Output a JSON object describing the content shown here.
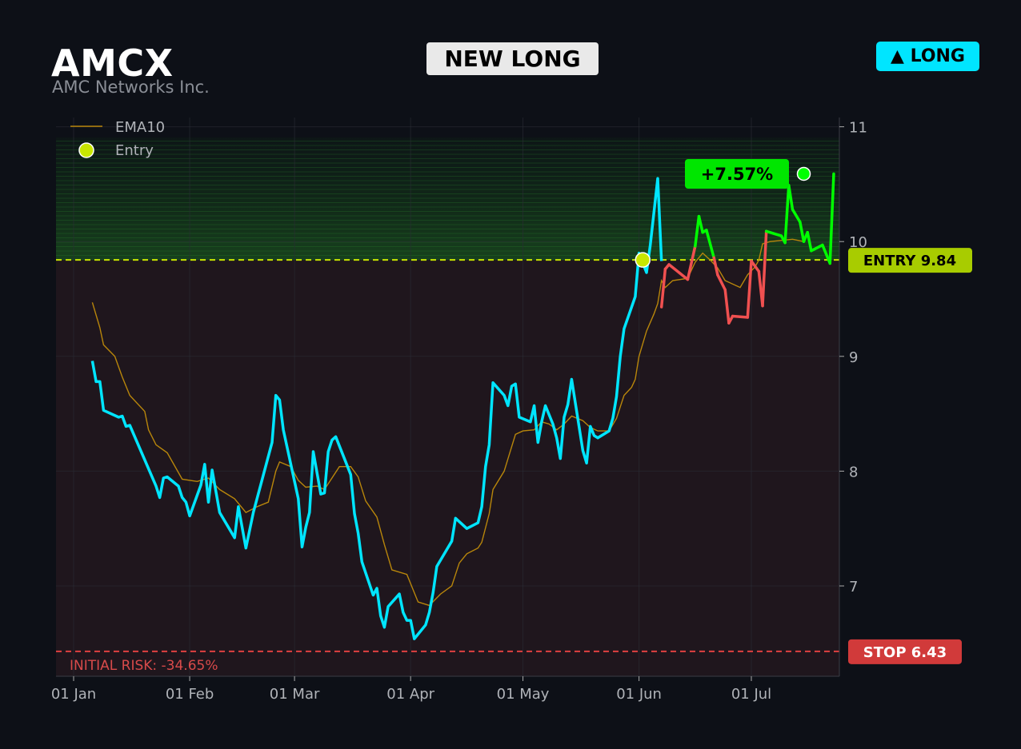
{
  "header": {
    "ticker": "AMCX",
    "company": "AMC Networks Inc.",
    "signal_label": "NEW LONG",
    "direction_badge": "▲ LONG"
  },
  "colors": {
    "background": "#0d1017",
    "price_line": "#00e5ff",
    "ema_line": "#b8860b",
    "profit_line": "#00ff00",
    "loss_line": "#f05050",
    "entry_line": "#c8e600",
    "stop_line": "#e04040",
    "entry_badge": "#a8cc00",
    "stop_badge": "#d13a3a",
    "gain_badge": "#00e600"
  },
  "chart_data": {
    "type": "line",
    "title": "",
    "xlabel": "",
    "ylabel": "",
    "ylim": [
      6.2,
      11.1
    ],
    "grid": true,
    "legend_position": "top-left",
    "x_ticks": [
      {
        "date": "2025-01-01",
        "label": "01 Jan"
      },
      {
        "date": "2025-02-01",
        "label": "01 Feb"
      },
      {
        "date": "2025-03-01",
        "label": "01 Mar"
      },
      {
        "date": "2025-04-01",
        "label": "01 Apr"
      },
      {
        "date": "2025-05-01",
        "label": "01 May"
      },
      {
        "date": "2025-06-01",
        "label": "01 Jun"
      },
      {
        "date": "2025-07-01",
        "label": "01 Jul"
      }
    ],
    "y_ticks": [
      7,
      8,
      9,
      10,
      11
    ],
    "legend": [
      "EMA10",
      "Entry"
    ],
    "entry": {
      "date": "2025-06-02",
      "price": 9.84,
      "label": "ENTRY 9.84"
    },
    "stop": {
      "price": 6.43,
      "label": "STOP 6.43"
    },
    "exit_marker": {
      "date": "2025-07-15",
      "price": 10.59
    },
    "gain_label": "+7.57%",
    "risk_label": "INITIAL RISK: -34.65%",
    "price": [
      [
        "2025-01-06",
        8.96
      ],
      [
        "2025-01-07",
        8.78
      ],
      [
        "2025-01-08",
        8.78
      ],
      [
        "2025-01-09",
        8.53
      ],
      [
        "2025-01-13",
        8.47
      ],
      [
        "2025-01-14",
        8.48
      ],
      [
        "2025-01-15",
        8.39
      ],
      [
        "2025-01-16",
        8.4
      ],
      [
        "2025-01-23",
        7.87
      ],
      [
        "2025-01-24",
        7.77
      ],
      [
        "2025-01-25",
        7.94
      ],
      [
        "2025-01-26",
        7.95
      ],
      [
        "2025-01-29",
        7.87
      ],
      [
        "2025-01-30",
        7.77
      ],
      [
        "2025-01-31",
        7.73
      ],
      [
        "2025-02-01",
        7.61
      ],
      [
        "2025-02-04",
        7.88
      ],
      [
        "2025-02-05",
        8.06
      ],
      [
        "2025-02-06",
        7.73
      ],
      [
        "2025-02-07",
        8.01
      ],
      [
        "2025-02-09",
        7.64
      ],
      [
        "2025-02-13",
        7.42
      ],
      [
        "2025-02-14",
        7.69
      ],
      [
        "2025-02-16",
        7.33
      ],
      [
        "2025-02-18",
        7.64
      ],
      [
        "2025-02-23",
        8.25
      ],
      [
        "2025-02-24",
        8.66
      ],
      [
        "2025-02-25",
        8.62
      ],
      [
        "2025-02-26",
        8.36
      ],
      [
        "2025-03-02",
        7.76
      ],
      [
        "2025-03-03",
        7.34
      ],
      [
        "2025-03-04",
        7.51
      ],
      [
        "2025-03-05",
        7.64
      ],
      [
        "2025-03-06",
        8.17
      ],
      [
        "2025-03-08",
        7.8
      ],
      [
        "2025-03-09",
        7.81
      ],
      [
        "2025-03-10",
        8.17
      ],
      [
        "2025-03-11",
        8.27
      ],
      [
        "2025-03-12",
        8.3
      ],
      [
        "2025-03-16",
        7.97
      ],
      [
        "2025-03-17",
        7.63
      ],
      [
        "2025-03-18",
        7.46
      ],
      [
        "2025-03-19",
        7.21
      ],
      [
        "2025-03-22",
        6.92
      ],
      [
        "2025-03-23",
        6.98
      ],
      [
        "2025-03-24",
        6.74
      ],
      [
        "2025-03-25",
        6.64
      ],
      [
        "2025-03-26",
        6.82
      ],
      [
        "2025-03-29",
        6.93
      ],
      [
        "2025-03-30",
        6.77
      ],
      [
        "2025-03-31",
        6.7
      ],
      [
        "2025-04-01",
        6.7
      ],
      [
        "2025-04-02",
        6.54
      ],
      [
        "2025-04-05",
        6.66
      ],
      [
        "2025-04-06",
        6.77
      ],
      [
        "2025-04-07",
        6.94
      ],
      [
        "2025-04-08",
        7.17
      ],
      [
        "2025-04-12",
        7.39
      ],
      [
        "2025-04-13",
        7.59
      ],
      [
        "2025-04-16",
        7.5
      ],
      [
        "2025-04-19",
        7.55
      ],
      [
        "2025-04-20",
        7.69
      ],
      [
        "2025-04-21",
        8.04
      ],
      [
        "2025-04-22",
        8.23
      ],
      [
        "2025-04-23",
        8.77
      ],
      [
        "2025-04-26",
        8.66
      ],
      [
        "2025-04-27",
        8.57
      ],
      [
        "2025-04-28",
        8.74
      ],
      [
        "2025-04-29",
        8.76
      ],
      [
        "2025-04-30",
        8.47
      ],
      [
        "2025-05-03",
        8.43
      ],
      [
        "2025-05-04",
        8.57
      ],
      [
        "2025-05-05",
        8.25
      ],
      [
        "2025-05-06",
        8.43
      ],
      [
        "2025-05-07",
        8.57
      ],
      [
        "2025-05-09",
        8.41
      ],
      [
        "2025-05-10",
        8.29
      ],
      [
        "2025-05-11",
        8.11
      ],
      [
        "2025-05-12",
        8.47
      ],
      [
        "2025-05-13",
        8.58
      ],
      [
        "2025-05-14",
        8.8
      ],
      [
        "2025-05-17",
        8.18
      ],
      [
        "2025-05-18",
        8.07
      ],
      [
        "2025-05-19",
        8.39
      ],
      [
        "2025-05-20",
        8.31
      ],
      [
        "2025-05-21",
        8.29
      ],
      [
        "2025-05-24",
        8.35
      ],
      [
        "2025-05-25",
        8.46
      ],
      [
        "2025-05-26",
        8.65
      ],
      [
        "2025-05-27",
        9.0
      ],
      [
        "2025-05-28",
        9.24
      ],
      [
        "2025-05-31",
        9.52
      ],
      [
        "2025-06-01",
        9.9
      ],
      [
        "2025-06-03",
        9.73
      ],
      [
        "2025-06-04",
        9.97
      ],
      [
        "2025-06-06",
        10.55
      ],
      [
        "2025-06-07",
        9.83
      ]
    ],
    "ema10": [
      [
        "2025-01-06",
        9.47
      ],
      [
        "2025-01-08",
        9.25
      ],
      [
        "2025-01-09",
        9.1
      ],
      [
        "2025-01-12",
        9.0
      ],
      [
        "2025-01-14",
        8.82
      ],
      [
        "2025-01-16",
        8.66
      ],
      [
        "2025-01-20",
        8.52
      ],
      [
        "2025-01-21",
        8.36
      ],
      [
        "2025-01-23",
        8.23
      ],
      [
        "2025-01-26",
        8.16
      ],
      [
        "2025-01-30",
        7.93
      ],
      [
        "2025-02-03",
        7.91
      ],
      [
        "2025-02-06",
        7.94
      ],
      [
        "2025-02-09",
        7.84
      ],
      [
        "2025-02-13",
        7.76
      ],
      [
        "2025-02-16",
        7.64
      ],
      [
        "2025-02-19",
        7.69
      ],
      [
        "2025-02-22",
        7.73
      ],
      [
        "2025-02-24",
        8.0
      ],
      [
        "2025-02-25",
        8.08
      ],
      [
        "2025-02-28",
        8.04
      ],
      [
        "2025-03-02",
        7.92
      ],
      [
        "2025-03-04",
        7.86
      ],
      [
        "2025-03-07",
        7.87
      ],
      [
        "2025-03-09",
        7.84
      ],
      [
        "2025-03-13",
        8.04
      ],
      [
        "2025-03-16",
        8.04
      ],
      [
        "2025-03-18",
        7.95
      ],
      [
        "2025-03-20",
        7.74
      ],
      [
        "2025-03-23",
        7.6
      ],
      [
        "2025-03-25",
        7.36
      ],
      [
        "2025-03-27",
        7.14
      ],
      [
        "2025-03-31",
        7.1
      ],
      [
        "2025-04-03",
        6.86
      ],
      [
        "2025-04-06",
        6.83
      ],
      [
        "2025-04-09",
        6.93
      ],
      [
        "2025-04-12",
        7.0
      ],
      [
        "2025-04-14",
        7.2
      ],
      [
        "2025-04-16",
        7.28
      ],
      [
        "2025-04-19",
        7.33
      ],
      [
        "2025-04-20",
        7.38
      ],
      [
        "2025-04-22",
        7.63
      ],
      [
        "2025-04-23",
        7.84
      ],
      [
        "2025-04-26",
        8.0
      ],
      [
        "2025-04-29",
        8.32
      ],
      [
        "2025-05-01",
        8.35
      ],
      [
        "2025-05-04",
        8.36
      ],
      [
        "2025-05-06",
        8.43
      ],
      [
        "2025-05-08",
        8.41
      ],
      [
        "2025-05-10",
        8.36
      ],
      [
        "2025-05-12",
        8.41
      ],
      [
        "2025-05-14",
        8.48
      ],
      [
        "2025-05-17",
        8.44
      ],
      [
        "2025-05-19",
        8.38
      ],
      [
        "2025-05-21",
        8.35
      ],
      [
        "2025-05-24",
        8.35
      ],
      [
        "2025-05-26",
        8.46
      ],
      [
        "2025-05-28",
        8.66
      ],
      [
        "2025-05-30",
        8.73
      ],
      [
        "2025-05-31",
        8.8
      ],
      [
        "2025-06-01",
        9.0
      ],
      [
        "2025-06-03",
        9.22
      ],
      [
        "2025-06-05",
        9.37
      ],
      [
        "2025-06-06",
        9.46
      ],
      [
        "2025-06-07",
        9.66
      ],
      [
        "2025-06-08",
        9.6
      ],
      [
        "2025-06-10",
        9.66
      ],
      [
        "2025-06-14",
        9.68
      ],
      [
        "2025-06-16",
        9.82
      ],
      [
        "2025-06-18",
        9.9
      ],
      [
        "2025-06-20",
        9.84
      ],
      [
        "2025-06-22",
        9.77
      ],
      [
        "2025-06-24",
        9.66
      ],
      [
        "2025-06-28",
        9.6
      ],
      [
        "2025-06-30",
        9.71
      ],
      [
        "2025-07-02",
        9.78
      ],
      [
        "2025-07-03",
        9.84
      ],
      [
        "2025-07-04",
        9.98
      ],
      [
        "2025-07-06",
        10.0
      ],
      [
        "2025-07-12",
        10.02
      ],
      [
        "2025-07-15",
        10.0
      ]
    ],
    "trade": [
      [
        "2025-06-07",
        9.43
      ],
      [
        "2025-06-08",
        9.76
      ],
      [
        "2025-06-09",
        9.8
      ],
      [
        "2025-06-14",
        9.67
      ],
      [
        "2025-06-16",
        9.96
      ],
      [
        "2025-06-17",
        10.22
      ],
      [
        "2025-06-18",
        10.08
      ],
      [
        "2025-06-19",
        10.1
      ],
      [
        "2025-06-21",
        9.86
      ],
      [
        "2025-06-22",
        9.71
      ],
      [
        "2025-06-24",
        9.58
      ],
      [
        "2025-06-25",
        9.29
      ],
      [
        "2025-06-26",
        9.35
      ],
      [
        "2025-06-30",
        9.34
      ],
      [
        "2025-07-01",
        9.83
      ],
      [
        "2025-07-03",
        9.74
      ],
      [
        "2025-07-04",
        9.44
      ],
      [
        "2025-07-05",
        10.09
      ],
      [
        "2025-07-09",
        10.05
      ],
      [
        "2025-07-10",
        9.99
      ],
      [
        "2025-07-11",
        10.49
      ],
      [
        "2025-07-12",
        10.28
      ],
      [
        "2025-07-14",
        10.17
      ],
      [
        "2025-07-15",
        10.0
      ],
      [
        "2025-07-16",
        10.08
      ],
      [
        "2025-07-17",
        9.92
      ],
      [
        "2025-07-20",
        9.97
      ],
      [
        "2025-07-22",
        9.81
      ],
      [
        "2025-07-23",
        10.59
      ]
    ]
  }
}
